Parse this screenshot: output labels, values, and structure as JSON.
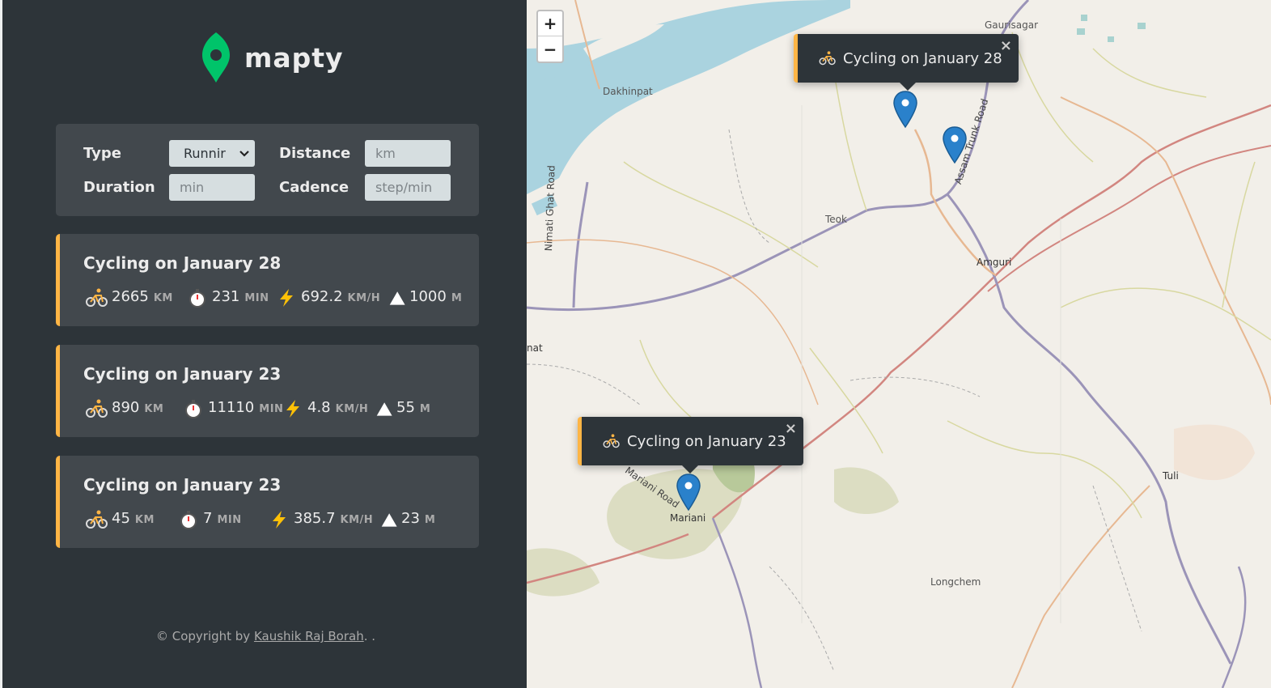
{
  "app": {
    "name": "mapty"
  },
  "form": {
    "type_label": "Type",
    "type_value": "Runnir",
    "distance_label": "Distance",
    "distance_placeholder": "km",
    "duration_label": "Duration",
    "duration_placeholder": "min",
    "cadence_label": "Cadence",
    "cadence_placeholder": "step/min"
  },
  "workouts": [
    {
      "title": "Cycling on January 28",
      "distance": "2665",
      "distance_unit": "KM",
      "duration": "231",
      "duration_unit": "MIN",
      "speed": "692.2",
      "speed_unit": "KM/H",
      "elevation": "1000",
      "elevation_unit": "M"
    },
    {
      "title": "Cycling on January 23",
      "distance": "890",
      "distance_unit": "KM",
      "duration": "11110",
      "duration_unit": "MIN",
      "speed": "4.8",
      "speed_unit": "KM/H",
      "elevation": "55",
      "elevation_unit": "M"
    },
    {
      "title": "Cycling on January 23",
      "distance": "45",
      "distance_unit": "KM",
      "duration": "7",
      "duration_unit": "MIN",
      "speed": "385.7",
      "speed_unit": "KM/H",
      "elevation": "23",
      "elevation_unit": "M"
    }
  ],
  "footer": {
    "prefix": "© Copyright by ",
    "author": "Kaushik Raj Borah",
    "suffix": ". ."
  },
  "map": {
    "zoom_in": "+",
    "zoom_out": "−",
    "popups": [
      {
        "text": "Cycling on January 28",
        "close": "×"
      },
      {
        "text": "Cycling on January 23",
        "close": "×"
      }
    ],
    "labels": {
      "gaurisagar": "Gaurisagar",
      "dakhinpat": "Dakhinpat",
      "teok": "Teok",
      "amguri": "Amguri",
      "nimati_ghat_road": "Nimati Ghat Road",
      "assam_trunk_road": "Assam Trunk Road",
      "nat": "nat",
      "mariani_road": "Mariani Road",
      "mariani": "Mariani",
      "tuli": "Tuli",
      "longchem": "Longchem"
    }
  },
  "colors": {
    "accent": "#ffb545",
    "brand": "#00c46a",
    "sidebar": "#2d3439",
    "card": "#42484d",
    "marker": "#2a81cb"
  }
}
